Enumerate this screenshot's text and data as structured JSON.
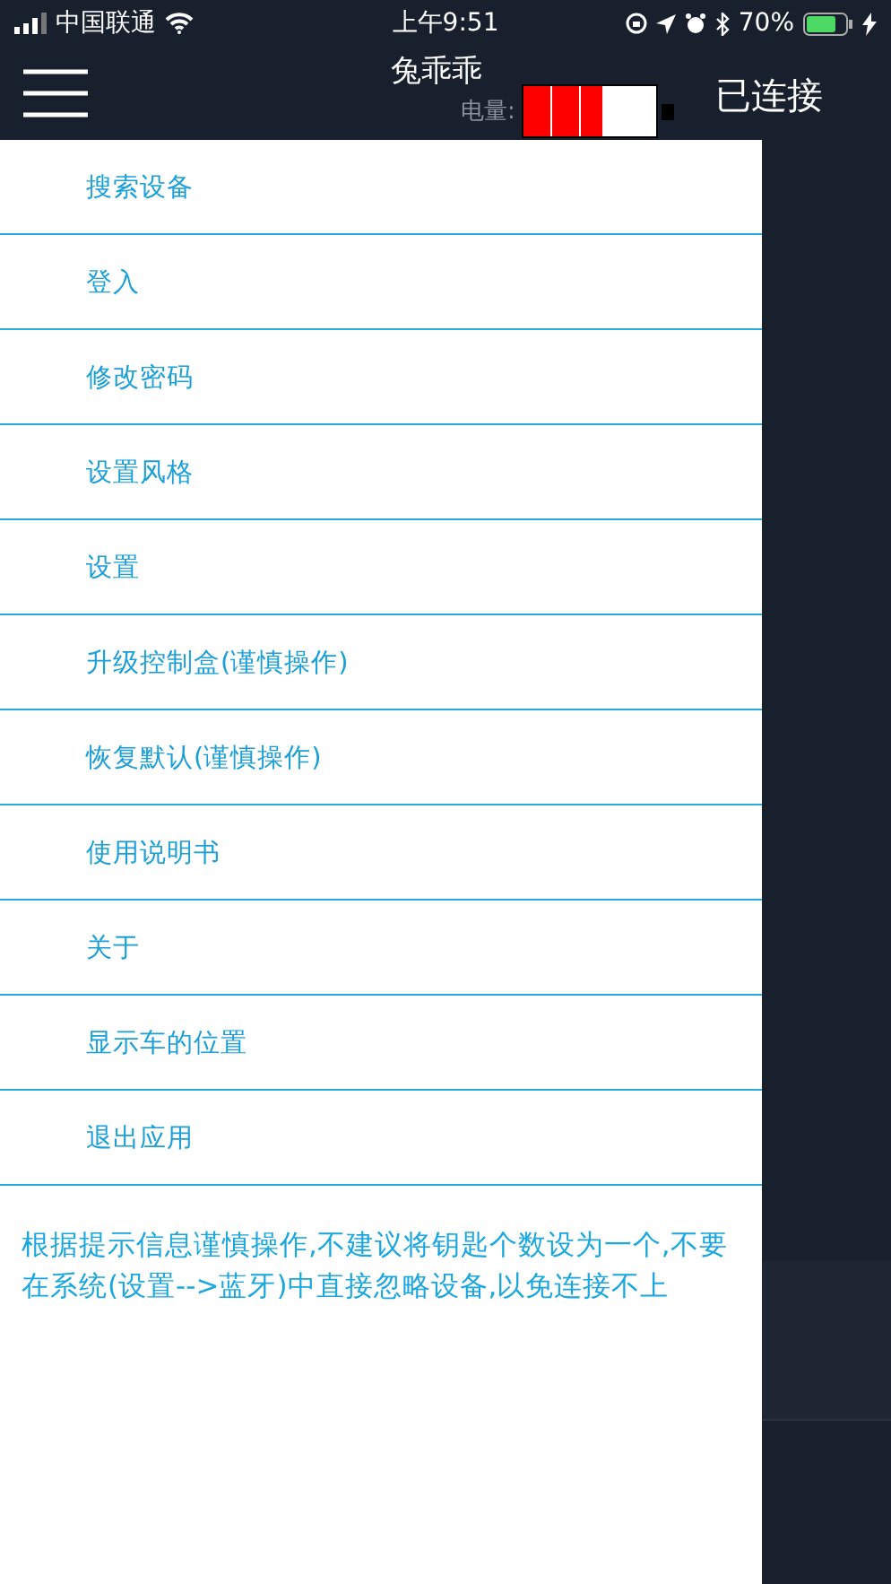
{
  "status_bar": {
    "carrier": "中国联通",
    "time": "上午9:51",
    "battery_percent": "70%"
  },
  "header": {
    "title": "兔乖乖",
    "battery_label": "电量:",
    "battery": {
      "level": 0.6
    },
    "connection": "已连接"
  },
  "menu": {
    "items": [
      {
        "label": "搜索设备"
      },
      {
        "label": "登入"
      },
      {
        "label": "修改密码"
      },
      {
        "label": "设置风格"
      },
      {
        "label": "设置"
      },
      {
        "label": "升级控制盒(谨慎操作)"
      },
      {
        "label": "恢复默认(谨慎操作)"
      },
      {
        "label": "使用说明书"
      },
      {
        "label": "关于"
      },
      {
        "label": "显示车的位置"
      },
      {
        "label": "退出应用"
      }
    ]
  },
  "notice": "根据提示信息谨慎操作,不建议将钥匙个数设为一个,不要在系统(设置-->蓝牙)中直接忽略设备,以免连接不上"
}
